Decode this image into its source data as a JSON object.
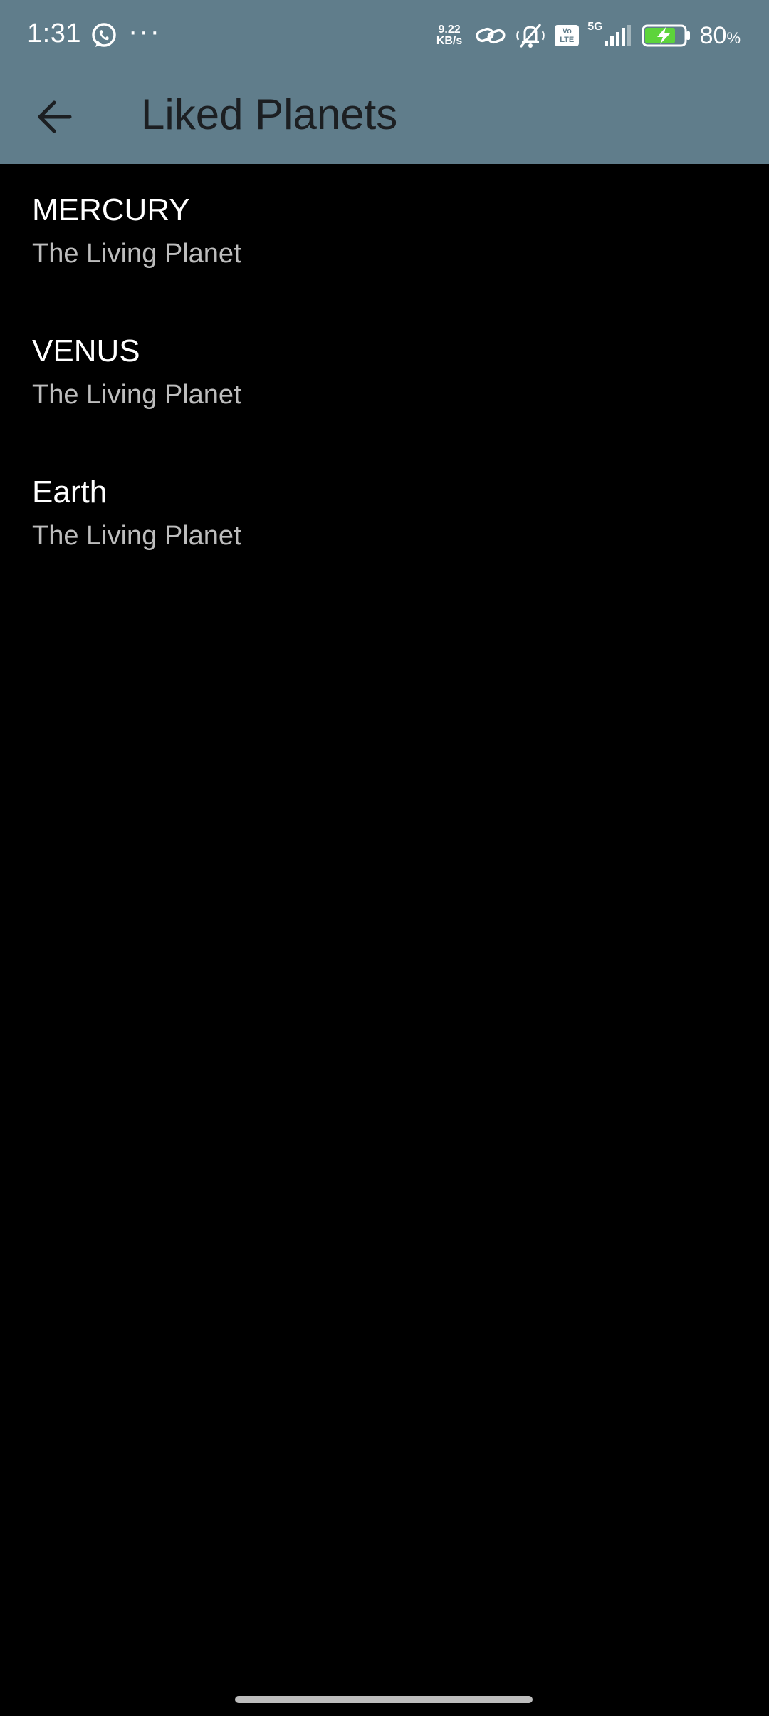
{
  "status_bar": {
    "time": "1:31",
    "more": "···",
    "net_speed_value": "9.22",
    "net_speed_unit": "KB/s",
    "volte_top": "Vo",
    "volte_bottom": "LTE",
    "network_type": "5G",
    "battery_percent": "80",
    "battery_unit": "%",
    "icons": [
      "whatsapp-icon",
      "more-icon",
      "link-icon",
      "bell-off-icon",
      "volte-icon",
      "signal-icon",
      "battery-charging-icon"
    ],
    "colors": {
      "background": "#607d8b",
      "battery_fill": "#5dd43b"
    }
  },
  "app_bar": {
    "title": "Liked Planets",
    "back_icon": "arrow-back-icon",
    "background": "#607d8b"
  },
  "list": {
    "items": [
      {
        "title": "MERCURY",
        "subtitle": "The Living Planet"
      },
      {
        "title": "VENUS",
        "subtitle": "The Living Planet"
      },
      {
        "title": "Earth",
        "subtitle": "The Living Planet"
      }
    ]
  }
}
